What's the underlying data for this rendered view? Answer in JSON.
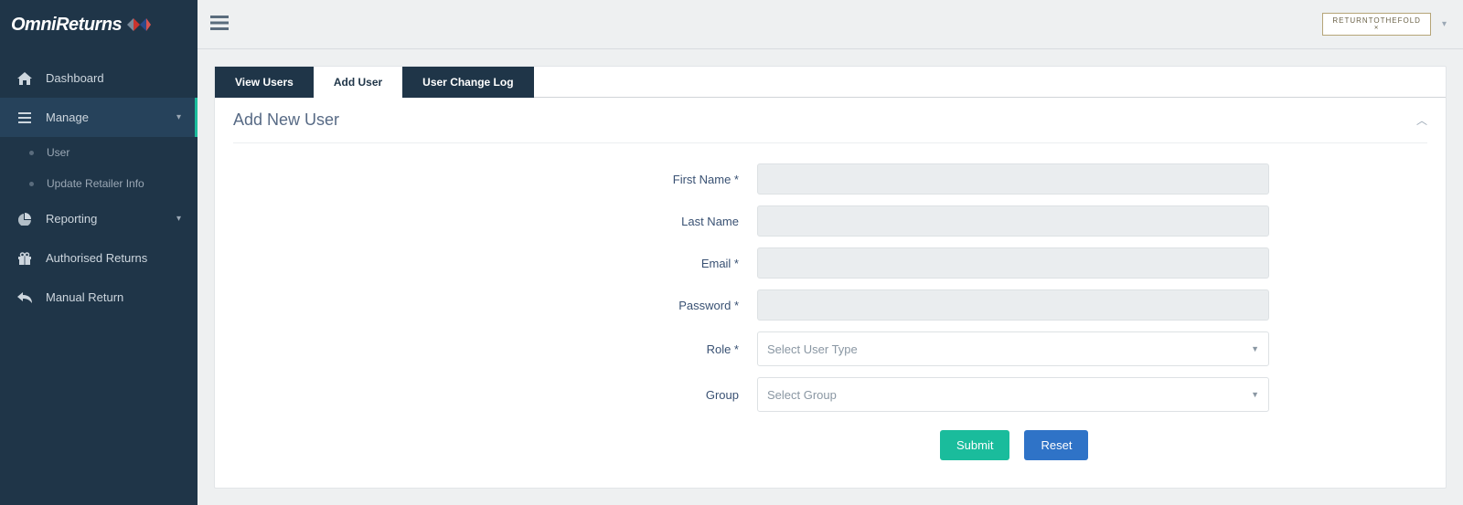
{
  "brand": "OmniReturns",
  "account_name": "RETURNTOTHEFOLD",
  "sidebar": {
    "items": [
      {
        "label": "Dashboard"
      },
      {
        "label": "Manage",
        "expanded": true,
        "children": [
          {
            "label": "User"
          },
          {
            "label": "Update Retailer Info"
          }
        ]
      },
      {
        "label": "Reporting"
      },
      {
        "label": "Authorised Returns"
      },
      {
        "label": "Manual Return"
      }
    ]
  },
  "tabs": {
    "view_users": "View Users",
    "add_user": "Add User",
    "user_change_log": "User Change Log"
  },
  "panel": {
    "title": "Add New User"
  },
  "form": {
    "first_name_label": "First Name *",
    "last_name_label": "Last Name",
    "email_label": "Email *",
    "password_label": "Password *",
    "role_label": "Role *",
    "group_label": "Group",
    "role_placeholder": "Select User Type",
    "group_placeholder": "Select Group",
    "submit_label": "Submit",
    "reset_label": "Reset"
  }
}
